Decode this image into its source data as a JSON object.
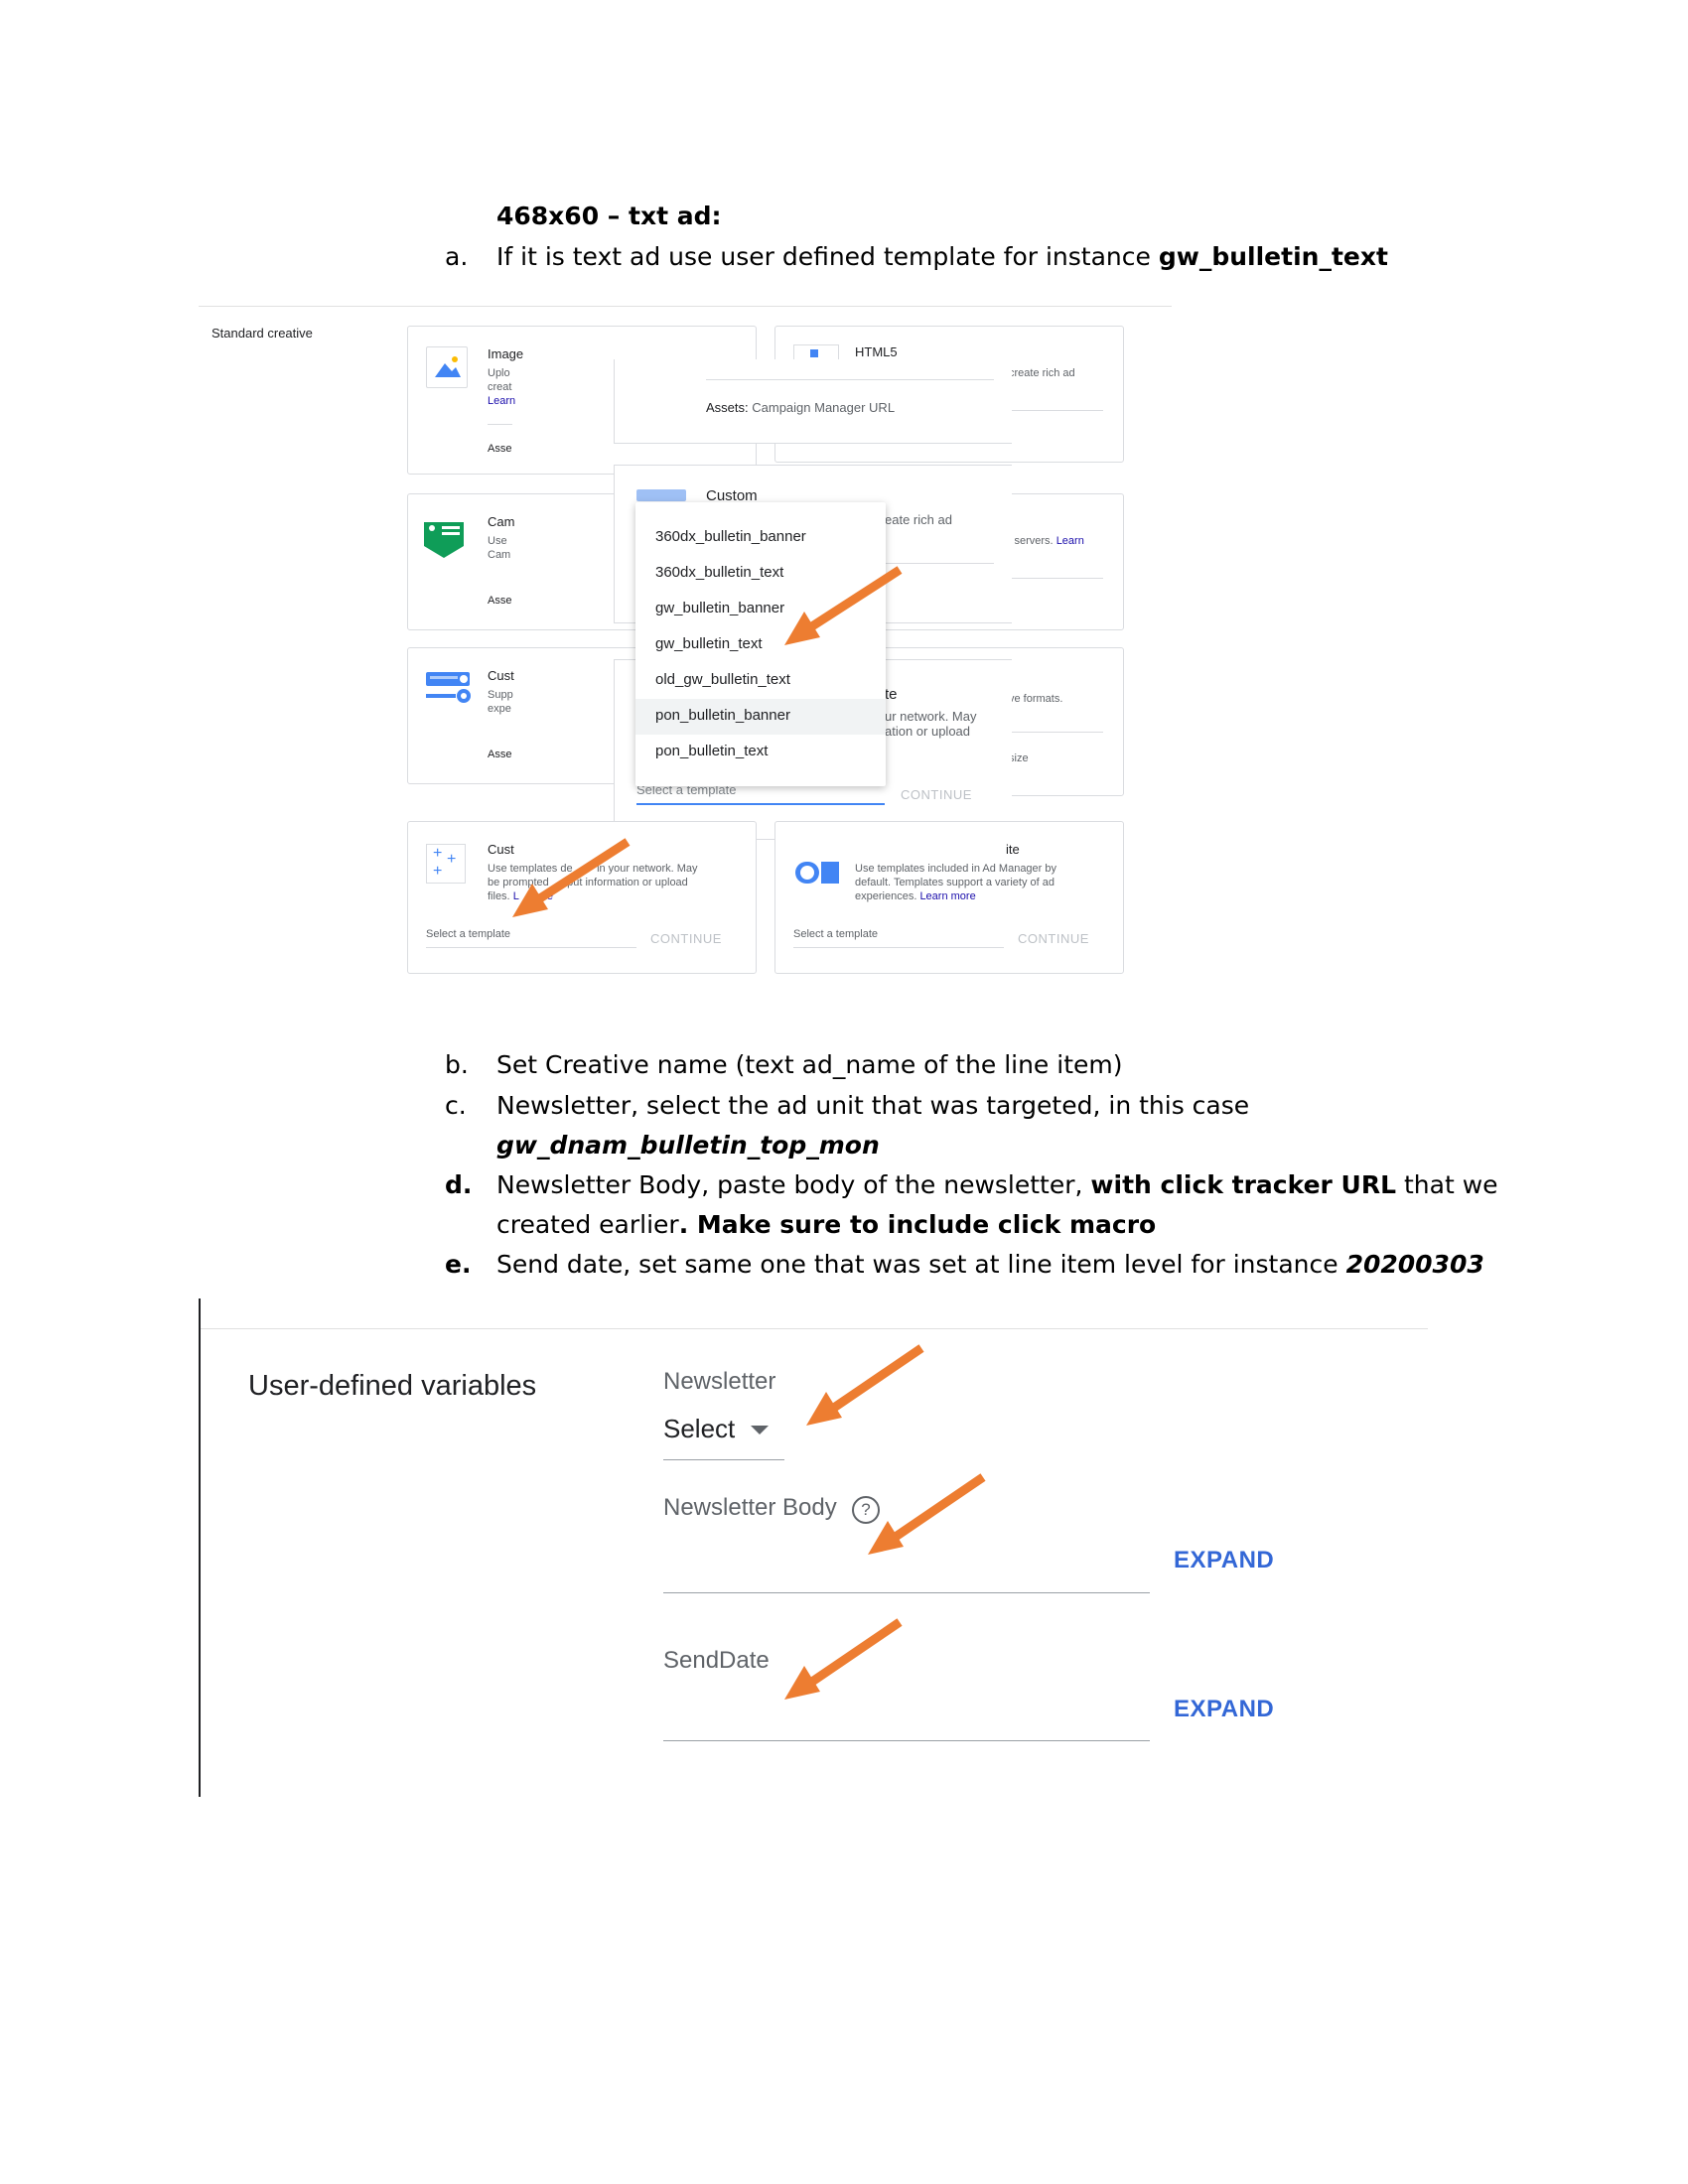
{
  "doc": {
    "heading": "468x60 – txt ad:",
    "a": {
      "marker": "a.",
      "text": "If it is text ad use user defined template for instance ",
      "bold": "gw_bulletin_text"
    },
    "b": {
      "marker": "b.",
      "text": "Set Creative name (text ad_name of the line item)"
    },
    "c": {
      "marker": "c.",
      "text": "Newsletter, select the ad unit that was targeted, in this case",
      "bold_italic": "gw_dnam_bulletin_top_mon"
    },
    "d": {
      "marker": "d.",
      "text1": "Newsletter Body, paste body of the newsletter, ",
      "bold1": "with click tracker URL",
      "text2": " that we",
      "text3": "created earlier",
      "bold2": ". Make sure to include click macro"
    },
    "e": {
      "marker": "e.",
      "text": "Send date, set same one that was set at line item level for instance ",
      "bold_italic": "20200303"
    }
  },
  "creative": {
    "section_label": "Standard creative",
    "image_card": {
      "title": "Image",
      "l1": "Uplo",
      "l2": "creat",
      "link": "Learn",
      "assets": "Asse"
    },
    "html5_card": {
      "title": "HTML5",
      "desc": "create rich ad"
    },
    "assets_row": {
      "label": "Assets:",
      "value": "Campaign Manager URL"
    },
    "campaign_card": {
      "title": "Cam",
      "l1": "Use",
      "l2": "Cam",
      "assets": "Asse"
    },
    "custom_overlay": {
      "title": "Custom",
      "desc": "eate rich ad"
    },
    "third_party_card": {
      "desc": "l servers. ",
      "link": "Learn"
    },
    "custom2_card": {
      "title": "Cust",
      "l1": "Supp",
      "l2": "expe",
      "assets": "Asse"
    },
    "native_overlay": {
      "title": "te",
      "l1": "ur network. May",
      "l2": "ation or upload"
    },
    "formats_card": {
      "desc": "ve formats.",
      "size": "size"
    },
    "dropdown": {
      "items": [
        "360dx_bulletin_banner",
        "360dx_bulletin_text",
        "gw_bulletin_banner",
        "gw_bulletin_text",
        "old_gw_bulletin_text",
        "pon_bulletin_banner",
        "pon_bulletin_text"
      ],
      "placeholder": "Select a template",
      "continue": "CONTINUE"
    },
    "user_template_card": {
      "title": "Cust",
      "l1": "Use templates de",
      "l1b": "in your network. May",
      "l2": "be prompted",
      "l2b": "put information or upload",
      "l3": "files.",
      "link": "L",
      "link2": "ore",
      "placeholder": "Select a template",
      "continue": "CONTINUE"
    },
    "system_template_card": {
      "title": "ite",
      "l1": "Use templates included in Ad Manager by",
      "l2": "default. Templates support a variety of ad",
      "l3": "experiences.",
      "link": "Learn more",
      "placeholder": "Select a template",
      "continue": "CONTINUE"
    }
  },
  "udv": {
    "title": "User-defined variables",
    "newsletter_label": "Newsletter",
    "newsletter_value": "Select",
    "body_label": "Newsletter Body",
    "senddate_label": "SendDate",
    "expand1": "EXPAND",
    "expand2": "EXPAND"
  },
  "colors": {
    "arrow": "#ed7d31",
    "link": "#3367d6",
    "accent_blue": "#4285f4",
    "green": "#0f9d58"
  }
}
